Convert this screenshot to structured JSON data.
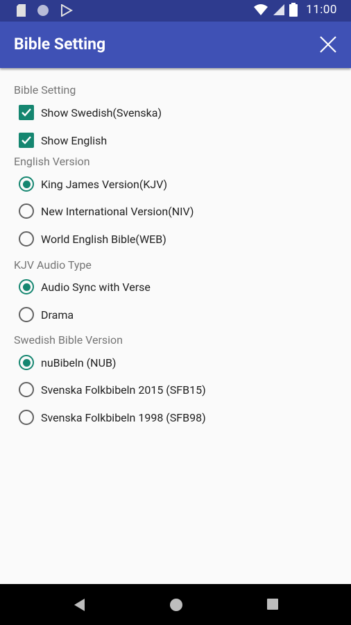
{
  "status_bar": {
    "time": "11:00"
  },
  "app_bar": {
    "title": "Bible Setting"
  },
  "sections": {
    "bible_setting": {
      "label": "Bible Setting",
      "options": [
        {
          "label": "Show Swedish(Svenska)",
          "checked": true
        },
        {
          "label": "Show English",
          "checked": true
        }
      ]
    },
    "english_version": {
      "label": "English Version",
      "options": [
        {
          "label": "King James Version(KJV)",
          "selected": true
        },
        {
          "label": "New International Version(NIV)",
          "selected": false
        },
        {
          "label": "World English Bible(WEB)",
          "selected": false
        }
      ]
    },
    "kjv_audio": {
      "label": "KJV Audio Type",
      "options": [
        {
          "label": "Audio Sync with Verse",
          "selected": true
        },
        {
          "label": "Drama",
          "selected": false
        }
      ]
    },
    "swedish_version": {
      "label": "Swedish Bible Version",
      "options": [
        {
          "label": "nuBibeln (NUB)",
          "selected": true
        },
        {
          "label": "Svenska Folkbibeln 2015 (SFB15)",
          "selected": false
        },
        {
          "label": "Svenska Folkbibeln 1998 (SFB98)",
          "selected": false
        }
      ]
    }
  },
  "colors": {
    "primary": "#3f51b5",
    "status_bar": "#2e3b8e",
    "accent": "#158670"
  }
}
